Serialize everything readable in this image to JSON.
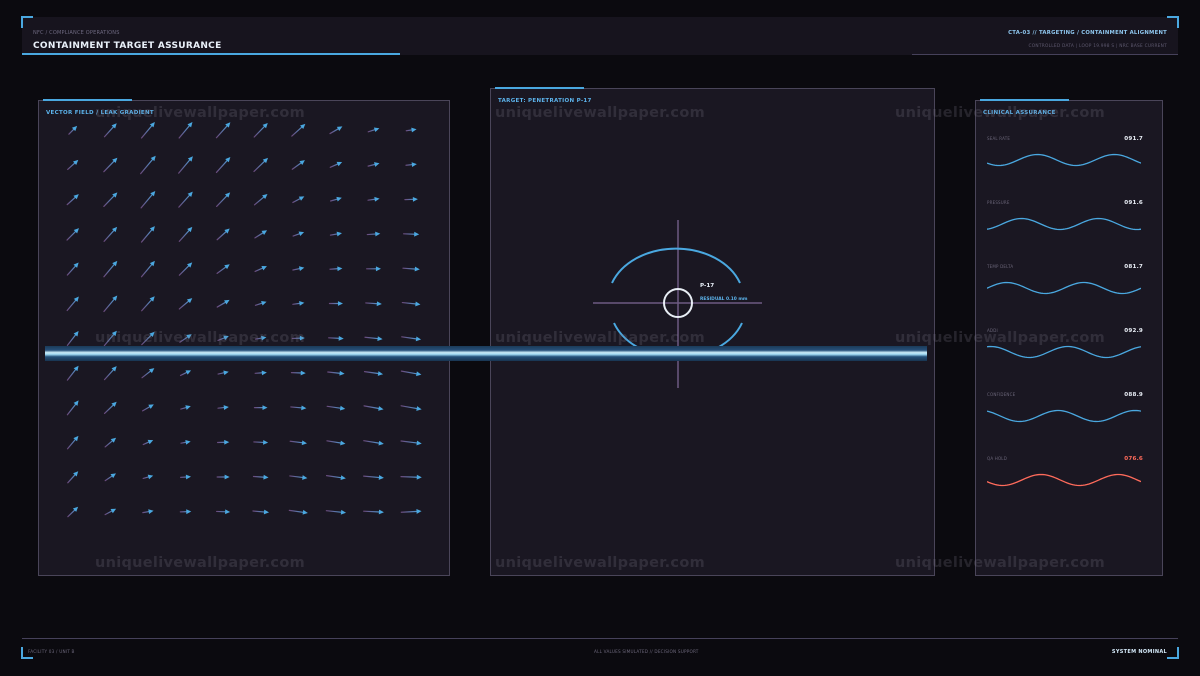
{
  "header": {
    "breadcrumb": "NFC / COMPLIANCE OPERATIONS",
    "title": "CONTAINMENT TARGET ASSURANCE",
    "module": "CTA-03 // TARGETING / CONTAINMENT ALIGNMENT",
    "status_line": "CONTROLLED DATA | LOOP 19.998 S | NRC BASE CURRENT"
  },
  "panels": {
    "vector_field": {
      "title": "VECTOR FIELD / LEAK GRADIENT",
      "angle_deg": [
        [
          45,
          48,
          50,
          50,
          48,
          46,
          42,
          30,
          18,
          8
        ],
        [
          42,
          46,
          50,
          50,
          48,
          44,
          36,
          24,
          14,
          6
        ],
        [
          42,
          46,
          50,
          48,
          46,
          40,
          28,
          16,
          8,
          2
        ],
        [
          45,
          48,
          50,
          48,
          42,
          32,
          20,
          10,
          4,
          -2
        ],
        [
          48,
          50,
          50,
          45,
          36,
          24,
          12,
          4,
          0,
          -4
        ],
        [
          50,
          50,
          48,
          40,
          30,
          18,
          8,
          0,
          -4,
          -6
        ],
        [
          52,
          50,
          45,
          34,
          22,
          10,
          2,
          -3,
          -6,
          -8
        ],
        [
          52,
          48,
          38,
          26,
          12,
          4,
          -2,
          -6,
          -8,
          -10
        ],
        [
          52,
          44,
          30,
          16,
          6,
          0,
          -5,
          -8,
          -10,
          -10
        ],
        [
          50,
          40,
          24,
          10,
          2,
          -3,
          -7,
          -9,
          -9,
          -7
        ],
        [
          48,
          34,
          16,
          4,
          0,
          -4,
          -7,
          -8,
          -5,
          -2
        ],
        [
          44,
          28,
          10,
          2,
          -2,
          -5,
          -8,
          -6,
          -3,
          3
        ]
      ],
      "magnitude": [
        [
          0.45,
          0.7,
          0.8,
          0.8,
          0.8,
          0.75,
          0.7,
          0.55,
          0.45,
          0.4
        ],
        [
          0.55,
          0.75,
          0.9,
          0.85,
          0.8,
          0.75,
          0.6,
          0.5,
          0.45,
          0.42
        ],
        [
          0.6,
          0.75,
          0.85,
          0.8,
          0.75,
          0.65,
          0.5,
          0.45,
          0.45,
          0.5
        ],
        [
          0.65,
          0.75,
          0.8,
          0.75,
          0.65,
          0.55,
          0.45,
          0.45,
          0.5,
          0.6
        ],
        [
          0.65,
          0.8,
          0.8,
          0.7,
          0.6,
          0.5,
          0.45,
          0.48,
          0.55,
          0.65
        ],
        [
          0.7,
          0.8,
          0.75,
          0.65,
          0.55,
          0.45,
          0.45,
          0.52,
          0.62,
          0.7
        ],
        [
          0.7,
          0.75,
          0.7,
          0.55,
          0.45,
          0.42,
          0.48,
          0.58,
          0.68,
          0.75
        ],
        [
          0.7,
          0.7,
          0.6,
          0.45,
          0.42,
          0.45,
          0.55,
          0.65,
          0.72,
          0.78
        ],
        [
          0.7,
          0.65,
          0.5,
          0.4,
          0.42,
          0.5,
          0.6,
          0.7,
          0.76,
          0.8
        ],
        [
          0.65,
          0.55,
          0.42,
          0.38,
          0.45,
          0.55,
          0.65,
          0.72,
          0.78,
          0.8
        ],
        [
          0.6,
          0.5,
          0.4,
          0.4,
          0.48,
          0.58,
          0.68,
          0.75,
          0.78,
          0.8
        ],
        [
          0.55,
          0.48,
          0.42,
          0.42,
          0.52,
          0.62,
          0.72,
          0.76,
          0.78,
          0.78
        ]
      ]
    },
    "target": {
      "title": "TARGET: PENETRATION P-17",
      "marker_label": "P-17",
      "residual": "RESIDUAL 0.10 mm"
    },
    "assurance": {
      "title": "CLINICAL ASSURANCE",
      "metrics": [
        {
          "label": "SEAL RATE",
          "value": "091.7",
          "value_color": "#e9eef6",
          "wave_color": "#4aa8e0"
        },
        {
          "label": "PRESSURE",
          "value": "091.6",
          "value_color": "#e9eef6",
          "wave_color": "#4aa8e0"
        },
        {
          "label": "TEMP DELTA",
          "value": "081.7",
          "value_color": "#e9eef6",
          "wave_color": "#4aa8e0"
        },
        {
          "label": "ADDI",
          "value": "092.9",
          "value_color": "#e9eef6",
          "wave_color": "#4aa8e0"
        },
        {
          "label": "CONFIDENCE",
          "value": "088.9",
          "value_color": "#e9eef6",
          "wave_color": "#4aa8e0"
        },
        {
          "label": "QA HOLD",
          "value": "076.6",
          "value_color": "#ff6b5b",
          "wave_color": "#ff6b5b"
        }
      ]
    }
  },
  "footer": {
    "location": "FACILITY 03 / UNIT B",
    "note": "ALL VALUES SIMULATED // DECISION SUPPORT",
    "status": "SYSTEM NOMINAL"
  },
  "watermark": "uniquelivewallpaper.com",
  "colors": {
    "accent": "#4aa8e0",
    "alert": "#ff6b5b",
    "vector_tail": "#6a4a7c",
    "reticle_lines": "#6c5a82",
    "reticle_ring": "#e8eef5"
  },
  "icons": {
    "target_reticle": "crosshair-icon",
    "frame_corners": "corner-bracket-icon"
  }
}
